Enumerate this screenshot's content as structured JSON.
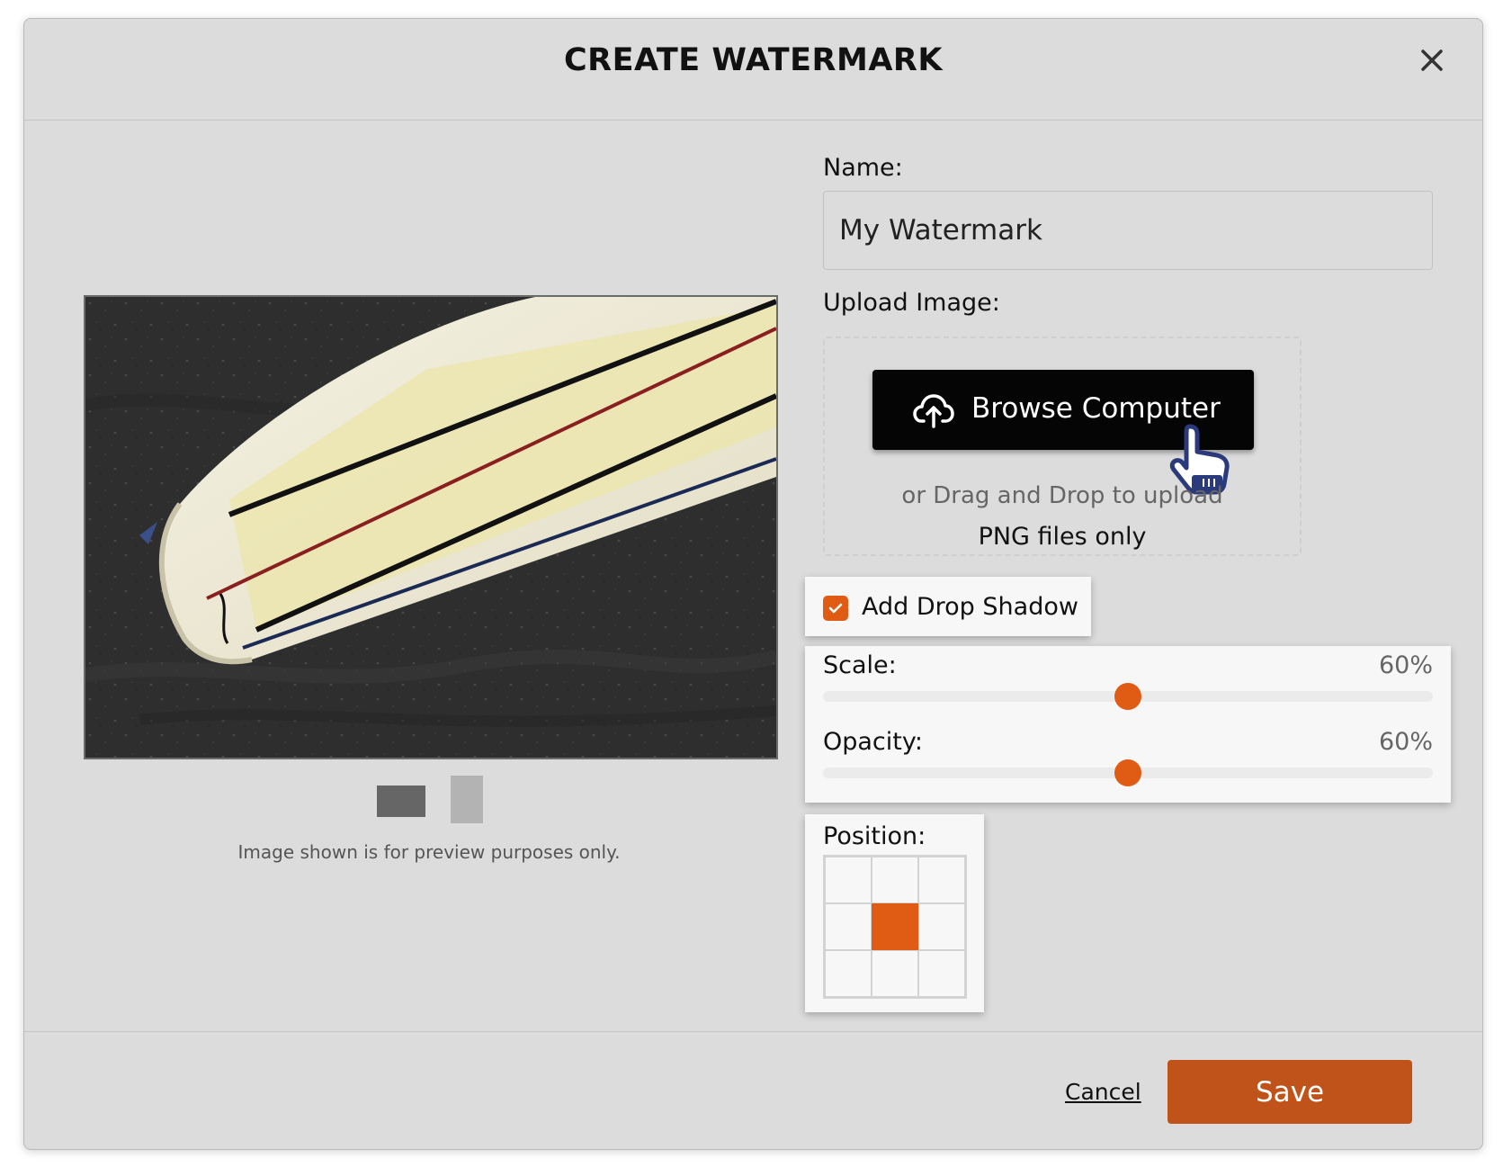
{
  "dialog": {
    "title": "CREATE WATERMARK"
  },
  "name_field": {
    "label": "Name:",
    "value": "My Watermark"
  },
  "upload": {
    "label": "Upload Image:",
    "browse_label": "Browse Computer",
    "drag_text": "or Drag and Drop to upload",
    "file_types": "PNG files only"
  },
  "drop_shadow": {
    "label": "Add Drop Shadow",
    "checked": true
  },
  "sliders": {
    "scale": {
      "label": "Scale:",
      "value_text": "60%",
      "value": 0.5
    },
    "opacity": {
      "label": "Opacity:",
      "value_text": "60%",
      "value": 0.5
    }
  },
  "position": {
    "label": "Position:",
    "selected": "middle-center"
  },
  "preview": {
    "note": "Image shown is for preview purposes only."
  },
  "footer": {
    "cancel_label": "Cancel",
    "save_label": "Save"
  },
  "colors": {
    "accent": "#e05b14",
    "save_button": "#c0531a",
    "dialog_bg": "#dcdcdc",
    "card_bg": "#f7f7f7",
    "browse_bg": "#050505"
  },
  "icons": {
    "close": "close-icon",
    "upload": "cloud-upload-icon",
    "cursor": "pointer-hand-icon",
    "check": "check-icon"
  }
}
